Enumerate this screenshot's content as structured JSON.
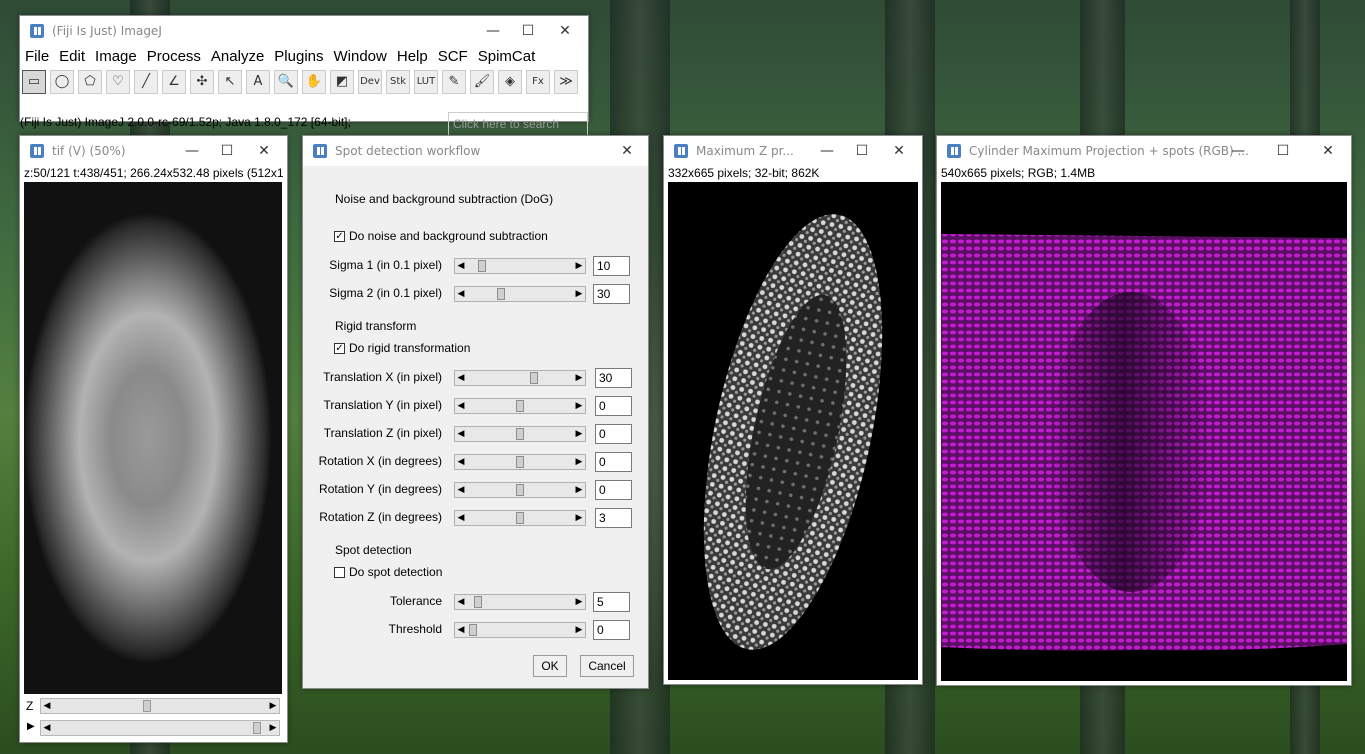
{
  "main_window": {
    "title": "(Fiji Is Just) ImageJ",
    "menu": [
      "File",
      "Edit",
      "Image",
      "Process",
      "Analyze",
      "Plugins",
      "Window",
      "Help",
      "SCF",
      "SpimCat"
    ],
    "tools": [
      {
        "name": "rectangle-tool-icon",
        "glyph": "▭"
      },
      {
        "name": "oval-tool-icon",
        "glyph": "◯"
      },
      {
        "name": "polygon-tool-icon",
        "glyph": "⬠"
      },
      {
        "name": "freehand-tool-icon",
        "glyph": "♡"
      },
      {
        "name": "line-tool-icon",
        "glyph": "╱"
      },
      {
        "name": "angle-tool-icon",
        "glyph": "∠"
      },
      {
        "name": "multipoint-tool-icon",
        "glyph": "✣"
      },
      {
        "name": "wand-tool-icon",
        "glyph": "↖"
      },
      {
        "name": "text-tool-icon",
        "glyph": "A"
      },
      {
        "name": "magnifier-tool-icon",
        "glyph": "🔍"
      },
      {
        "name": "hand-tool-icon",
        "glyph": "✋"
      },
      {
        "name": "color-picker-icon",
        "glyph": "◩"
      },
      {
        "name": "dev-menu-icon",
        "glyph": "Dev"
      },
      {
        "name": "stk-menu-icon",
        "glyph": "Stk"
      },
      {
        "name": "lut-menu-icon",
        "glyph": "LUT"
      },
      {
        "name": "pencil-tool-icon",
        "glyph": "✎"
      },
      {
        "name": "brush-tool-icon",
        "glyph": "🖌"
      },
      {
        "name": "flood-fill-tool-icon",
        "glyph": "◈"
      },
      {
        "name": "fx-tool-icon",
        "glyph": "Fx"
      },
      {
        "name": "more-tools-icon",
        "glyph": "≫"
      }
    ],
    "status": "(Fiji Is Just) ImageJ 2.0.0-rc-69/1.52p; Java 1.8.0_172 [64-bit];",
    "search_placeholder": "Click here to search"
  },
  "tif_window": {
    "title": "tif (V) (50%)",
    "info": "z:50/121 t:438/451; 266.24x532.48 pixels (512x1",
    "z_label": "Z",
    "z_position": 0.43,
    "t_position": 0.97
  },
  "dialog": {
    "title": "Spot detection workflow",
    "sections": {
      "dog": "Noise and background subtraction (DoG)",
      "rigid": "Rigid transform",
      "spot": "Spot detection"
    },
    "checkboxes": {
      "dog": {
        "label": "Do noise and background subtraction",
        "checked": true
      },
      "rigid": {
        "label": "Do rigid transformation",
        "checked": true
      },
      "spot": {
        "label": "Do spot detection",
        "checked": false
      }
    },
    "params": {
      "sigma1": {
        "label": "Sigma 1 (in 0.1 pixel)",
        "value": "10",
        "pos": 0.1
      },
      "sigma2": {
        "label": "Sigma 2 (in 0.1 pixel)",
        "value": "30",
        "pos": 0.3
      },
      "tx": {
        "label": "Translation X (in pixel)",
        "value": "30",
        "pos": 0.65
      },
      "ty": {
        "label": "Translation Y (in pixel)",
        "value": "0",
        "pos": 0.5
      },
      "tz": {
        "label": "Translation Z (in pixel)",
        "value": "0",
        "pos": 0.5
      },
      "rx": {
        "label": "Rotation X (in degrees)",
        "value": "0",
        "pos": 0.5
      },
      "ry": {
        "label": "Rotation Y (in degrees)",
        "value": "0",
        "pos": 0.5
      },
      "rz": {
        "label": "Rotation Z (in degrees)",
        "value": "3",
        "pos": 0.5
      },
      "tolerance": {
        "label": "Tolerance",
        "value": "5",
        "pos": 0.05
      },
      "threshold": {
        "label": "Threshold",
        "value": "0",
        "pos": 0.0
      }
    },
    "ok": "OK",
    "cancel": "Cancel"
  },
  "maxz_window": {
    "title": "Maximum Z pr...",
    "info": "332x665 pixels; 32-bit; 862K"
  },
  "cyl_window": {
    "title": "Cylinder Maximum Projection + spots (RGB) ...",
    "info": "540x665 pixels; RGB; 1.4MB"
  },
  "colors": {
    "magenta": "#c21bd0",
    "checkbox_mark": "✓"
  }
}
